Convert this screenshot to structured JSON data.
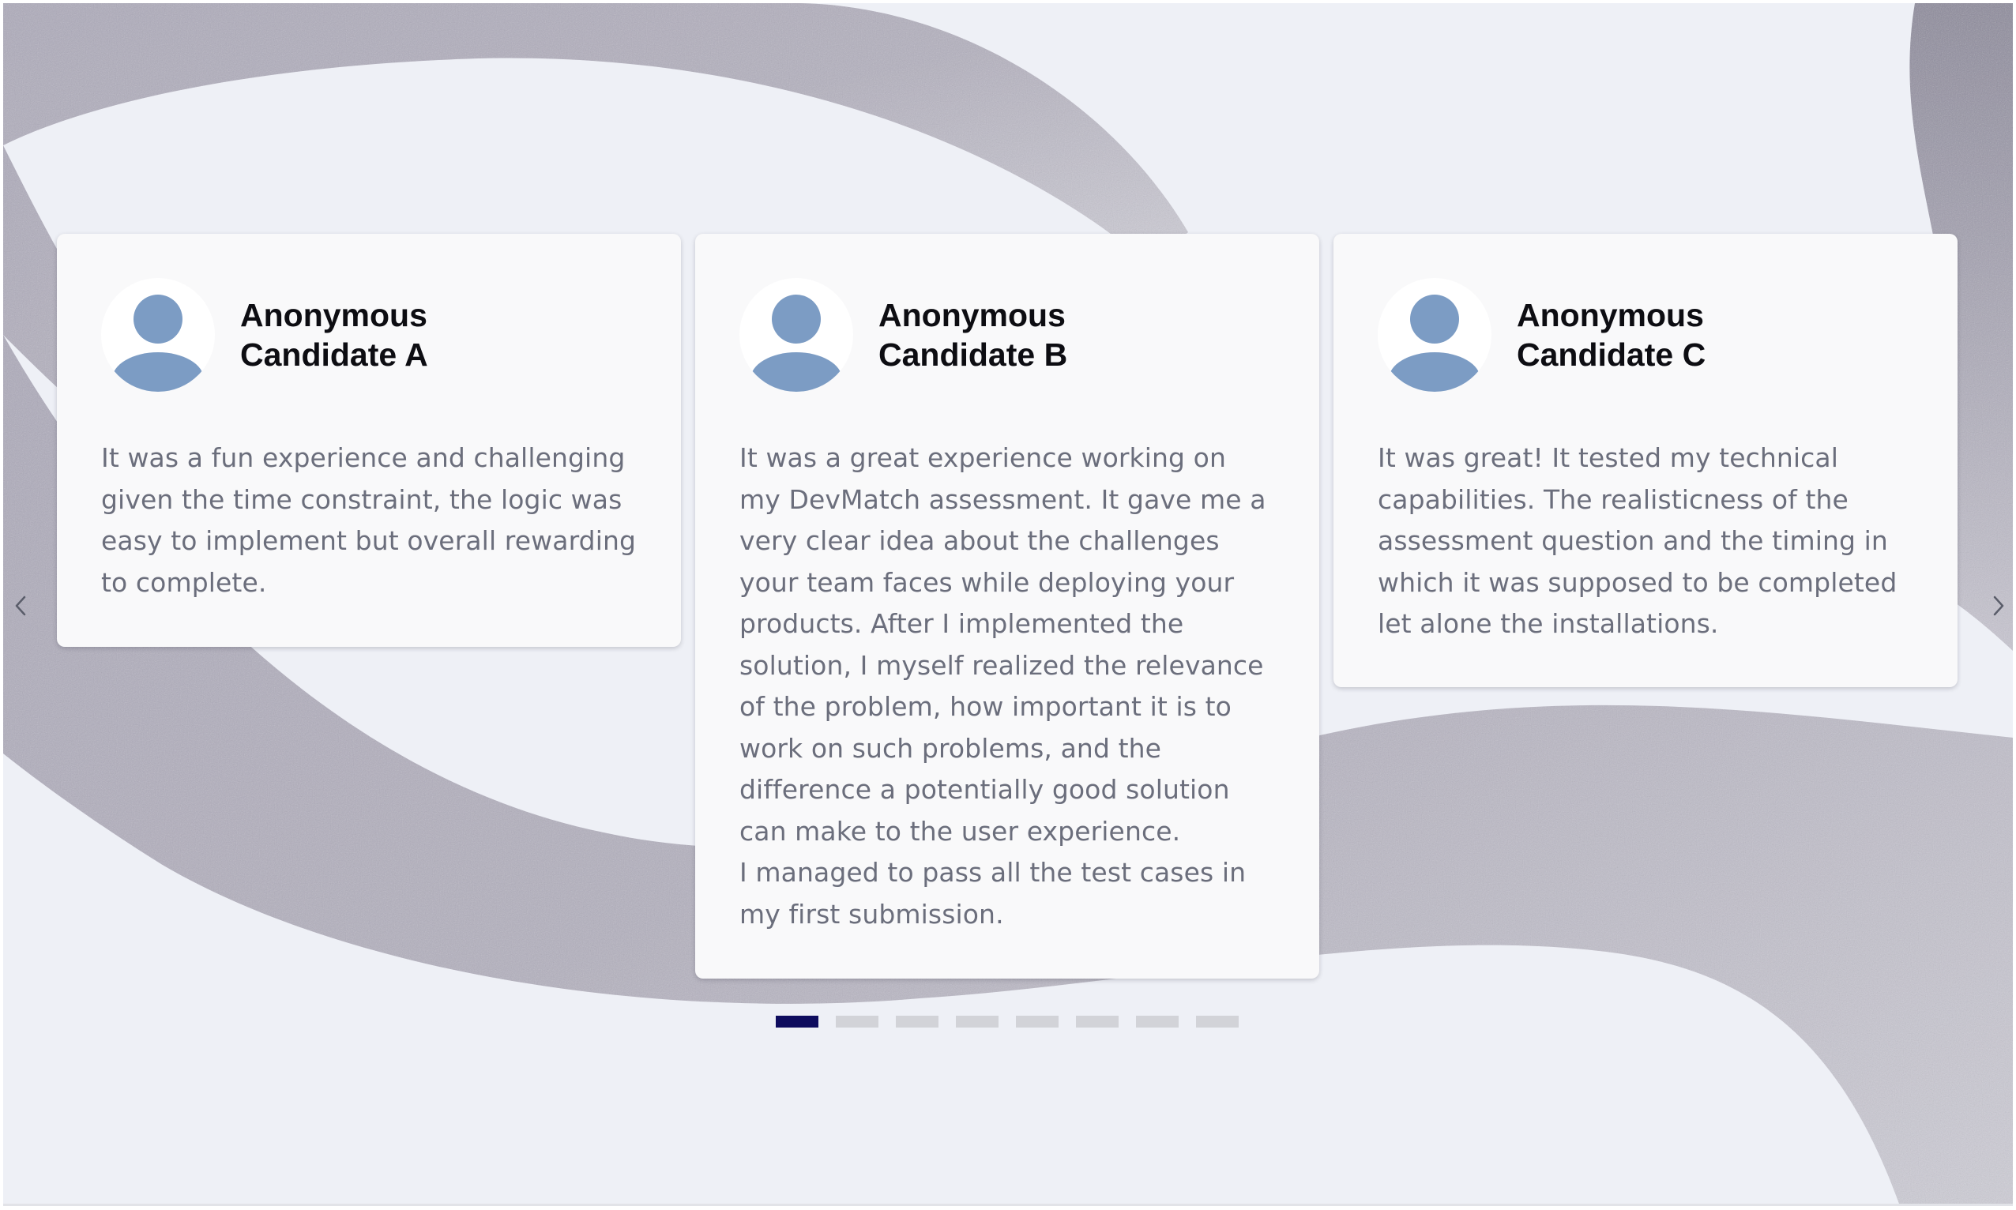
{
  "carousel": {
    "prev_icon": "chevron-left-icon",
    "next_icon": "chevron-right-icon",
    "cards": [
      {
        "avatar_icon": "user-avatar-icon",
        "name": "Anonymous Candidate A",
        "quote": "It was a fun experience and challenging given the time constraint, the logic was easy to implement but overall rewarding to complete."
      },
      {
        "avatar_icon": "user-avatar-icon",
        "name": "Anonymous Candidate B",
        "quote": "It was a great experience working on my DevMatch assessment. It gave me a very clear idea about the challenges your team faces while deploying your products. After I implemented the solution, I myself realized the relevance of the problem, how important it is to work on such problems, and the difference a potentially good solution can make to the user experience.\nI managed to pass all the test cases in my first submission."
      },
      {
        "avatar_icon": "user-avatar-icon",
        "name": "Anonymous Candidate C",
        "quote": "It was great! It tested my technical capabilities. The realisticness of the assessment question and the timing in which it was supposed to be completed let alone the installations."
      }
    ],
    "pagination": {
      "total_pages": 8,
      "active_page": 1
    }
  },
  "colors": {
    "background": "#eef0f6",
    "card": "#f9f9fa",
    "avatar": "#7c9cc4",
    "name_text": "#0d0d12",
    "quote_text": "#6b6e7c",
    "dot_active": "#0e0c5e",
    "dot_inactive": "#d2d3d8"
  }
}
